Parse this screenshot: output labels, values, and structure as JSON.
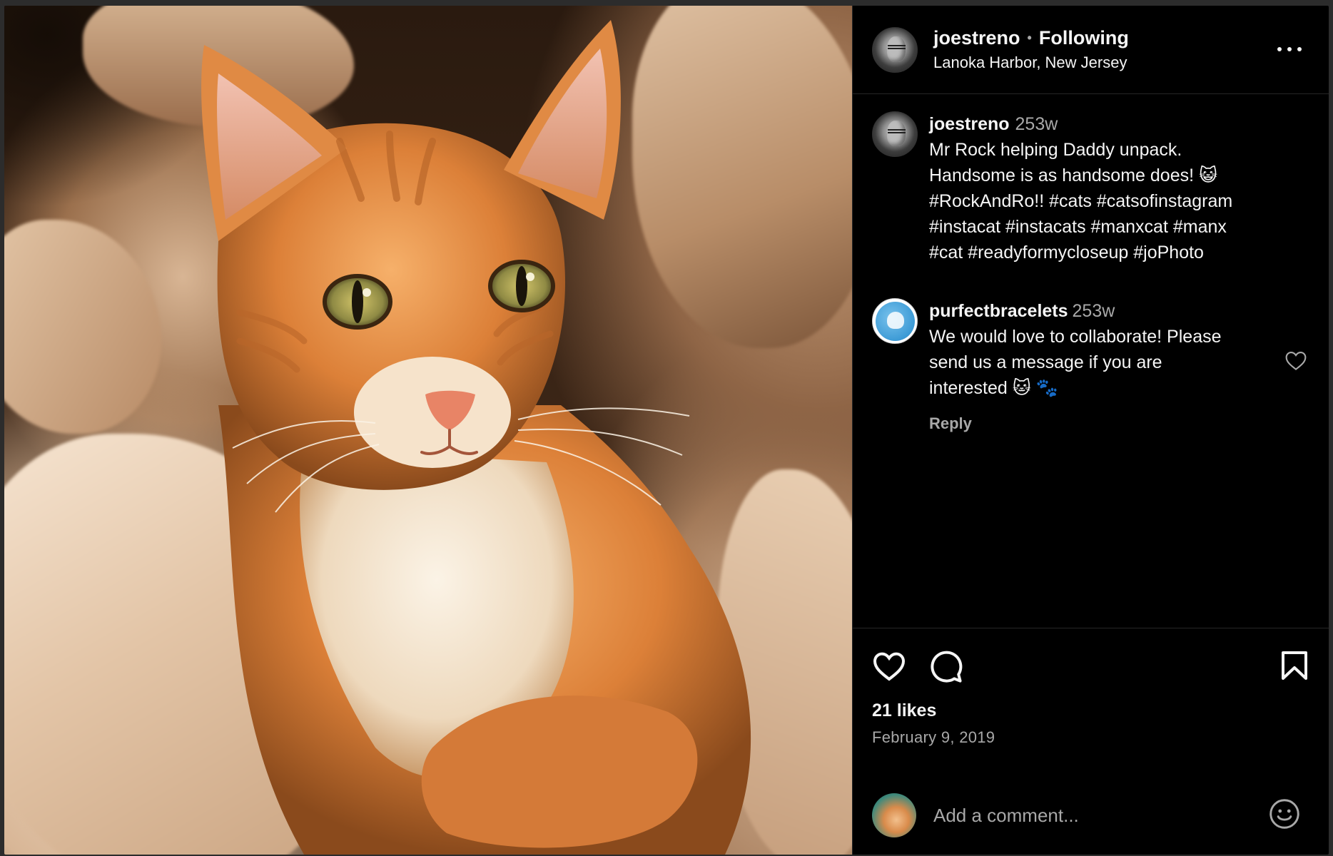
{
  "post": {
    "image_alt": "Orange tabby cat nestled in brown packing paper",
    "author": {
      "username": "joestreno",
      "follow_status": "Following",
      "location": "Lanoka Harbor, New Jersey"
    },
    "caption": {
      "username": "joestreno",
      "time": "253w",
      "lines": [
        "Mr Rock helping Daddy unpack.",
        "Handsome is as handsome does! 😺",
        "#RockAndRo!! #cats #catsofinstagram",
        "#instacat #instacats #manxcat #manx",
        "#cat #readyformycloseup #joPhoto"
      ]
    },
    "comments": [
      {
        "username": "purfectbracelets",
        "time": "253w",
        "lines": [
          "We would love to collaborate! Please",
          "send us a message if you are",
          "interested 🐱 🐾"
        ],
        "reply_label": "Reply"
      }
    ],
    "likes_text": "21 likes",
    "date_text": "February 9, 2019",
    "comment_placeholder": "Add a comment..."
  },
  "icons": {
    "more": "more-options-icon",
    "like": "heart-icon",
    "comment": "comment-icon",
    "save": "bookmark-icon",
    "emoji": "emoji-icon"
  },
  "colors": {
    "background": "#000000",
    "text": "#f5f5f5",
    "secondary_text": "#a8a8a8",
    "divider": "#262626"
  }
}
